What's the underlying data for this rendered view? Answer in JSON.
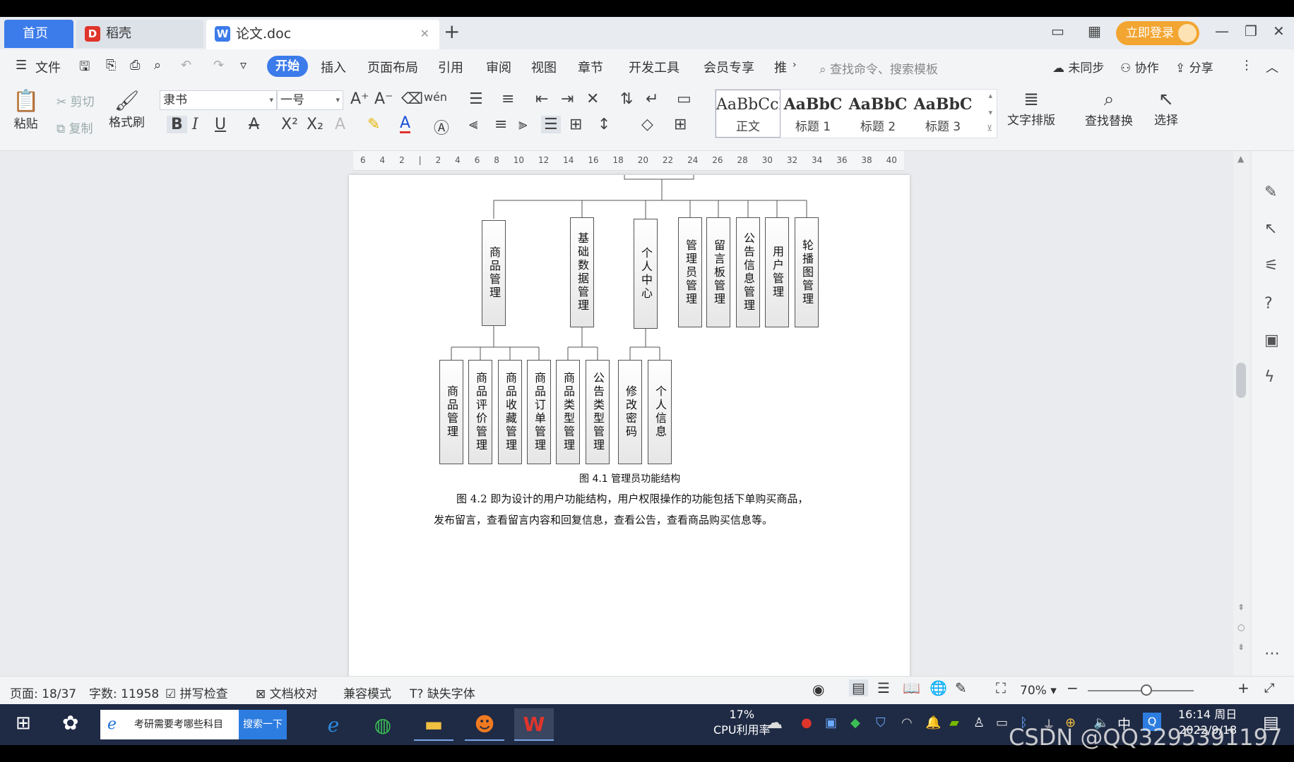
{
  "tabs": {
    "home": "首页",
    "daoke": "稻壳",
    "document": "论文.doc",
    "login": "立即登录"
  },
  "menu": {
    "file": "文件",
    "items": [
      "开始",
      "插入",
      "页面布局",
      "引用",
      "审阅",
      "视图",
      "章节",
      "开发工具",
      "会员专享",
      "推"
    ],
    "search_placeholder": "查找命令、搜索模板",
    "unsynced": "未同步",
    "collaborate": "协作",
    "share": "分享"
  },
  "ribbon": {
    "paste": "粘贴",
    "cut": "剪切",
    "copy": "复制",
    "format_painter": "格式刷",
    "font_name": "隶书",
    "font_size": "一号",
    "styles": [
      {
        "sample": "AaBbCcI",
        "name": "正文"
      },
      {
        "sample": "AaBbC",
        "name": "标题 1"
      },
      {
        "sample": "AaBbC",
        "name": "标题 2"
      },
      {
        "sample": "AaBbC",
        "name": "标题 3"
      }
    ],
    "text_layout": "文字排版",
    "find_replace": "查找替换",
    "select": "选择"
  },
  "ruler": {
    "ticks": [
      "6",
      "4",
      "2",
      "",
      "2",
      "4",
      "6",
      "8",
      "10",
      "12",
      "14",
      "16",
      "18",
      "20",
      "22",
      "24",
      "26",
      "28",
      "30",
      "32",
      "34",
      "36",
      "38",
      "40"
    ]
  },
  "document": {
    "level1": [
      "商品管理",
      "基础数据管理",
      "个人中心",
      "管理员管理",
      "留言板管理",
      "公告信息管理",
      "用户管理",
      "轮播图管理"
    ],
    "level2_goods": [
      "商品管理",
      "商品评价管理",
      "商品收藏管理",
      "商品订单管理"
    ],
    "level2_base": [
      "商品类型管理",
      "公告类型管理"
    ],
    "level2_personal": [
      "修改密码",
      "个人信息"
    ],
    "caption": "图 4.1  管理员功能结构",
    "para_line1": "图 4.2 即为设计的用户功能结构，用户权限操作的功能包括下单购买商品，",
    "para_line2": "发布留言，查看留言内容和回复信息，查看公告，查看商品购买信息等。"
  },
  "status": {
    "page": "页面: 18/37",
    "words": "字数: 11958",
    "spellcheck": "拼写检查",
    "doc_check": "文档校对",
    "compat_mode": "兼容模式",
    "missing_fonts": "缺失字体",
    "zoom": "70%",
    "zoom_level": 0.7
  },
  "taskbar": {
    "search_text": "考研需要考哪些科目",
    "search_button": "搜索一下",
    "cpu_percent": "17%",
    "cpu_label": "CPU利用率",
    "ime": "中",
    "time": "16:14 周日",
    "date": "2022/9/18"
  },
  "watermark": "CSDN @QQ3295391197"
}
